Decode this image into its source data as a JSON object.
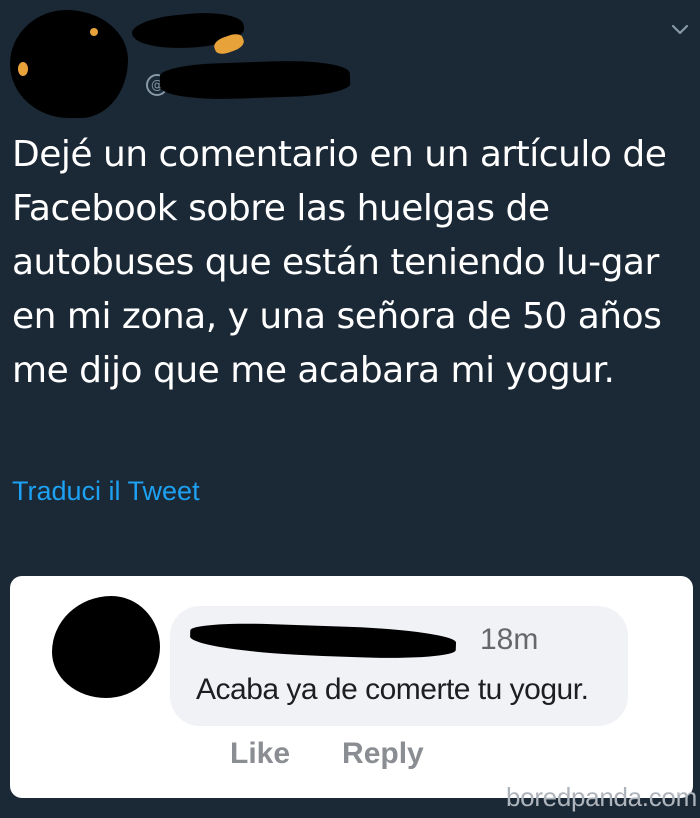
{
  "tweet": {
    "text": "Dejé un comentario en un artículo de Facebook sobre las huelgas de autobuses que están teniendo lu-gar en mi zona, y una señora de 50 años me dijo que me acabara mi yogur.",
    "translate_label": "Traduci il Tweet"
  },
  "icons": {
    "chevron": "chevron-down-icon",
    "handle_at": "at-sign-icon"
  },
  "facebook_comment": {
    "timestamp": "18m",
    "text": "Acaba ya de comerte tu yogur.",
    "like_label": "Like",
    "reply_label": "Reply"
  },
  "watermark": {
    "text": "boredpanda.com"
  },
  "colors": {
    "background": "#1b2836",
    "link": "#1da1f2",
    "card": "#ffffff",
    "bubble": "#f1f2f6"
  }
}
